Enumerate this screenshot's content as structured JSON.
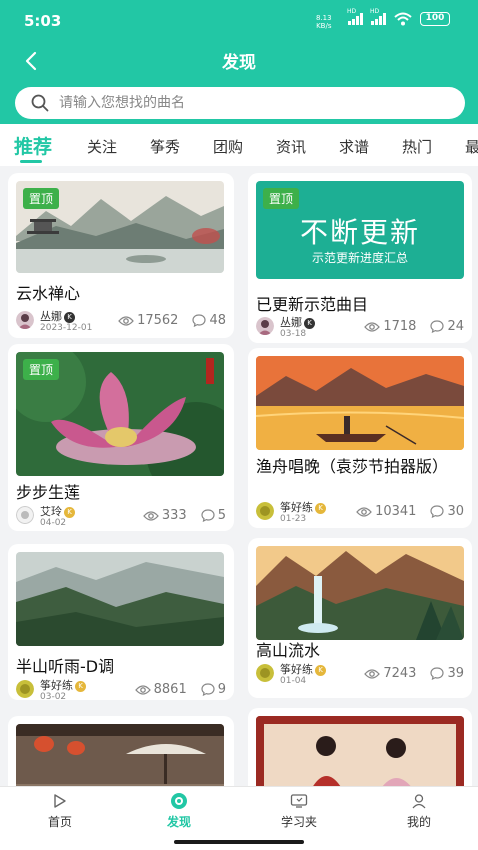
{
  "status_bar": {
    "time": "5:03",
    "speed_value": "8.13",
    "speed_unit": "KB/s",
    "battery": "100"
  },
  "navbar": {
    "title": "发现"
  },
  "search": {
    "placeholder": "请输入您想找的曲名"
  },
  "tabs": [
    "推荐",
    "关注",
    "筝秀",
    "团购",
    "资讯",
    "求谱",
    "热门",
    "最"
  ],
  "pinned_label": "置顶",
  "cards": [
    {
      "title": "云水禅心",
      "author": "丛娜",
      "date": "2023-12-01",
      "views": "17562",
      "comments": "48",
      "pinned": true
    },
    {
      "title": "已更新示范曲目",
      "author": "丛娜",
      "date": "03-18",
      "views": "1718",
      "comments": "24",
      "pinned": true,
      "banner": {
        "big": "不断更新",
        "small": "示范更新进度汇总"
      }
    },
    {
      "title": "步步生莲",
      "author": "艾玲",
      "date": "04-02",
      "views": "333",
      "comments": "5",
      "pinned": true
    },
    {
      "title": "渔舟唱晚（袁莎节拍器版）",
      "author": "筝好练",
      "date": "01-23",
      "views": "10341",
      "comments": "30"
    },
    {
      "title": "半山听雨-D调",
      "author": "筝好练",
      "date": "03-02",
      "views": "8861",
      "comments": "9"
    },
    {
      "title": "高山流水",
      "author": "筝好练",
      "date": "01-04",
      "views": "7243",
      "comments": "39"
    }
  ],
  "bottom_nav": [
    {
      "label": "首页",
      "icon": "play-icon"
    },
    {
      "label": "发现",
      "icon": "discover-icon"
    },
    {
      "label": "学习夹",
      "icon": "folder-icon"
    },
    {
      "label": "我的",
      "icon": "profile-icon"
    }
  ],
  "colors": {
    "accent": "#22c7a5",
    "pin_green": "#3db04a",
    "banner_green": "#1daf94"
  }
}
